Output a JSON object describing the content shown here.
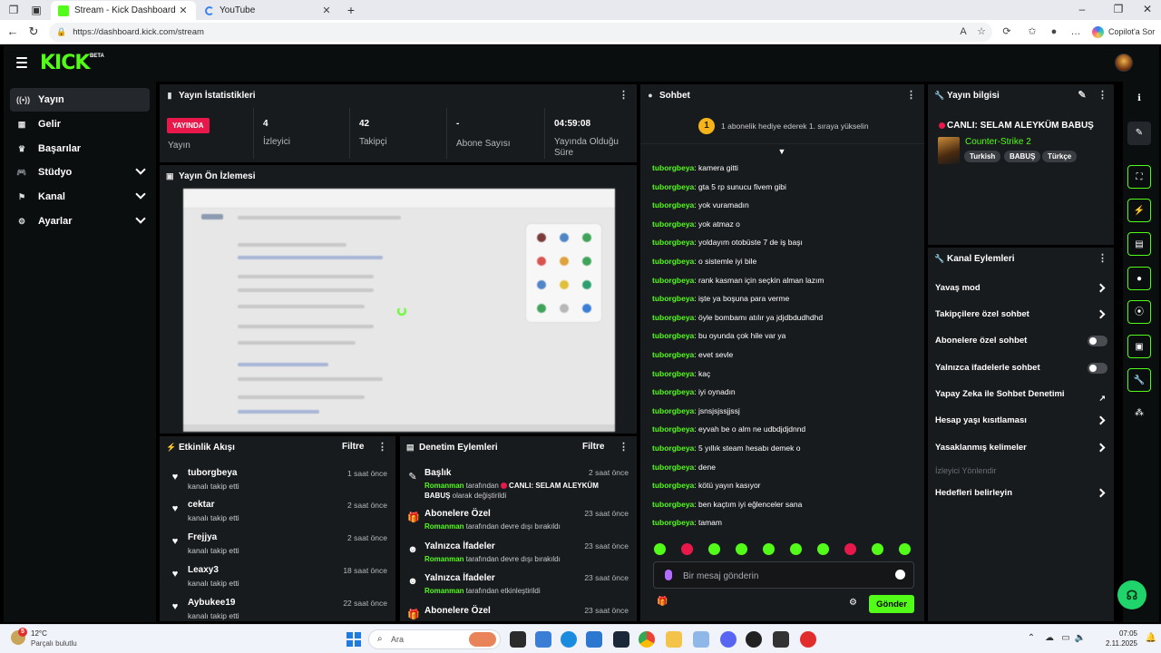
{
  "browser": {
    "tabs": [
      {
        "title": "Stream - Kick Dashboard",
        "active": true
      },
      {
        "title": "YouTube",
        "active": false
      }
    ],
    "url": "https://dashboard.kick.com/stream",
    "copilot_label": "Copilot'a Sor"
  },
  "brand": {
    "logo": "KICK",
    "beta": "BETA",
    "accent": "#53fc18",
    "live_red": "#e8194a"
  },
  "sidebar": {
    "items": [
      {
        "label": "Yayın",
        "icon": "broadcast-icon",
        "active": true
      },
      {
        "label": "Gelir",
        "icon": "revenue-icon"
      },
      {
        "label": "Başarılar",
        "icon": "achievements-icon"
      },
      {
        "label": "Stüdyo",
        "icon": "studio-icon",
        "expandable": true
      },
      {
        "label": "Kanal",
        "icon": "channel-icon",
        "expandable": true
      },
      {
        "label": "Ayarlar",
        "icon": "settings-icon",
        "expandable": true
      }
    ]
  },
  "stats": {
    "title": "Yayın İstatistikleri",
    "live_badge": "YAYINDA",
    "live_label": "Yayın",
    "viewers_value": "4",
    "viewers_label": "İzleyici",
    "followers_value": "42",
    "followers_label": "Takipçi",
    "subs_value": "-",
    "subs_label": "Abone Sayısı",
    "uptime_value": "04:59:08",
    "uptime_label": "Yayında Olduğu Süre"
  },
  "preview": {
    "title": "Yayın Ön İzlemesi"
  },
  "activity": {
    "title": "Etkinlik Akışı",
    "filter": "Filtre",
    "items": [
      {
        "name": "tuborgbeya",
        "desc": "kanalı takip etti",
        "time": "1 saat önce"
      },
      {
        "name": "cektar",
        "desc": "kanalı takip etti",
        "time": "2 saat önce"
      },
      {
        "name": "Frejjya",
        "desc": "kanalı takip etti",
        "time": "2 saat önce"
      },
      {
        "name": "Leaxy3",
        "desc": "kanalı takip etti",
        "time": "18 saat önce"
      },
      {
        "name": "Aybukee19",
        "desc": "kanalı takip etti",
        "time": "22 saat önce"
      }
    ]
  },
  "moderation": {
    "title": "Denetim Eylemleri",
    "filter": "Filtre",
    "items": [
      {
        "name": "Başlık",
        "user": "Romanman",
        "pre": " tarafından ",
        "highlight": "CANLI: SELAM ALEYKÜM BABUŞ",
        "post": " olarak değiştirildi",
        "time": "2 saat önce",
        "icon": "title-edit-icon"
      },
      {
        "name": "Abonelere Özel",
        "user": "Romanman",
        "pre": " tarafından devre dışı bırakıldı",
        "highlight": "",
        "post": "",
        "time": "23 saat önce",
        "icon": "gift-icon"
      },
      {
        "name": "Yalnızca İfadeler",
        "user": "Romanman",
        "pre": " tarafından devre dışı bırakıldı",
        "highlight": "",
        "post": "",
        "time": "23 saat önce",
        "icon": "emote-icon"
      },
      {
        "name": "Yalnızca İfadeler",
        "user": "Romanman",
        "pre": " tarafından etkinleştirildi",
        "highlight": "",
        "post": "",
        "time": "23 saat önce",
        "icon": "emote-icon"
      },
      {
        "name": "Abonelere Özel",
        "user": "",
        "pre": "",
        "highlight": "",
        "post": "",
        "time": "23 saat önce",
        "icon": "gift-icon"
      }
    ]
  },
  "chat": {
    "title": "Sohbet",
    "gift_badge": "1",
    "gift_text": "1 abonelik hediye ederek 1. sıraya yükselin",
    "messages": [
      {
        "user": "tuborgbeya",
        "text": "kamera gitti"
      },
      {
        "user": "tuborgbeya",
        "text": "gta 5 rp sunucu fivem gibi"
      },
      {
        "user": "tuborgbeya",
        "text": "yok vuramadın"
      },
      {
        "user": "tuborgbeya",
        "text": "yok atmaz o"
      },
      {
        "user": "tuborgbeya",
        "text": "yoldayım otobüste 7 de iş başı"
      },
      {
        "user": "tuborgbeya",
        "text": "o sistemle iyi bile"
      },
      {
        "user": "tuborgbeya",
        "text": "rank kasman için seçkin alman lazım"
      },
      {
        "user": "tuborgbeya",
        "text": "işte ya boşuna para verme"
      },
      {
        "user": "tuborgbeya",
        "text": "öyle bombamı atılır ya jdjdbdudhdhd"
      },
      {
        "user": "tuborgbeya",
        "text": "bu oyunda çok hile var ya"
      },
      {
        "user": "tuborgbeya",
        "text": "evet sevle"
      },
      {
        "user": "tuborgbeya",
        "text": "kaç"
      },
      {
        "user": "tuborgbeya",
        "text": "iyi oynadın"
      },
      {
        "user": "tuborgbeya",
        "text": "jsnsjsjssjjssj"
      },
      {
        "user": "tuborgbeya",
        "text": "eyvah be o alm ne udbdjdjdnnd"
      },
      {
        "user": "tuborgbeya",
        "text": "5 yıllık steam hesabı demek o"
      },
      {
        "user": "tuborgbeya",
        "text": "dene"
      },
      {
        "user": "tuborgbeya",
        "text": "kötü yayın kasıyor"
      },
      {
        "user": "tuborgbeya",
        "text": "ben kaçtım iyi eğlenceler sana"
      },
      {
        "user": "tuborgbeya",
        "text": "tamam"
      }
    ],
    "input_placeholder": "Bir mesaj gönderin",
    "send_label": "Gönder"
  },
  "stream_info": {
    "title": "Yayın bilgisi",
    "stream_title": "CANLI: SELAM ALEYKÜM BABUŞ",
    "game": "Counter-Strike 2",
    "tags": [
      "Turkish",
      "BABUŞ",
      "Türkçe"
    ]
  },
  "channel_actions": {
    "title": "Kanal Eylemleri",
    "items": [
      {
        "label": "Yavaş mod",
        "control": "chevron"
      },
      {
        "label": "Takipçilere özel sohbet",
        "control": "chevron"
      },
      {
        "label": "Abonelere özel sohbet",
        "control": "toggle",
        "on": false
      },
      {
        "label": "Yalnızca ifadelerle sohbet",
        "control": "toggle",
        "on": false
      },
      {
        "label": "Yapay Zeka ile Sohbet Denetimi",
        "control": "external"
      },
      {
        "label": "Hesap yaşı kısıtlaması",
        "control": "chevron"
      },
      {
        "label": "Yasaklanmış kelimeler",
        "control": "chevron"
      },
      {
        "label": "İzleyici Yönlendir",
        "control": "none",
        "disabled": true
      },
      {
        "label": "Hedefleri belirleyin",
        "control": "chevron"
      }
    ]
  },
  "taskbar": {
    "temp": "12°C",
    "weather": "Parçalı bulutlu",
    "weather_badge": "5",
    "search_placeholder": "Ara",
    "time": "07:05",
    "date": "2.11.2025"
  }
}
